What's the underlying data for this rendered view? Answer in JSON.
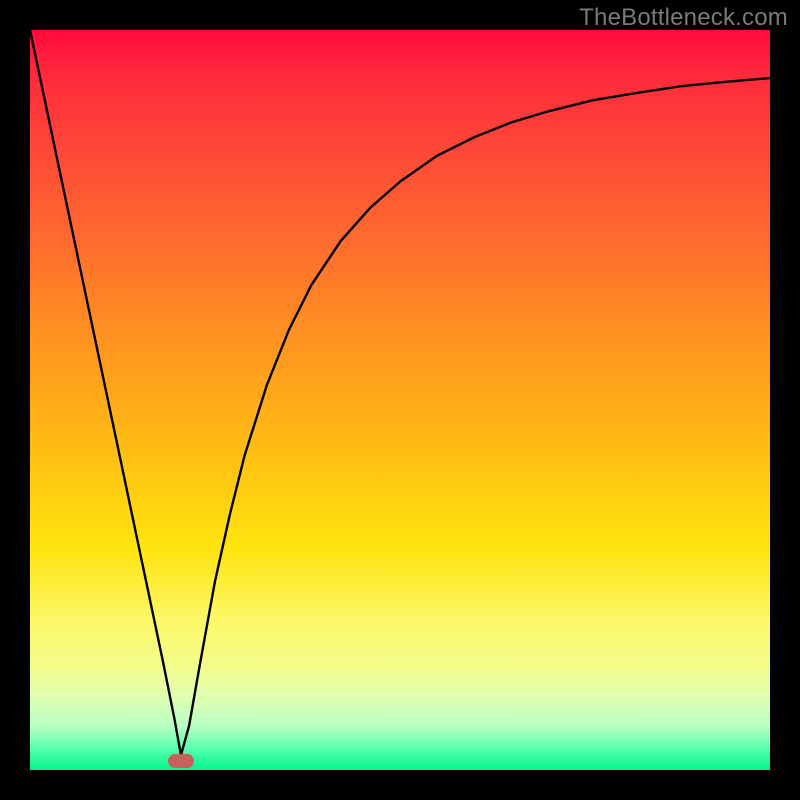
{
  "watermark": "TheBottleneck.com",
  "gradient_colors": {
    "top": "#ff0a3c",
    "mid_upper": "#ff6a2f",
    "mid": "#ffe40e",
    "mid_lower": "#f4fc8b",
    "bottom": "#00f58c"
  },
  "marker": {
    "x_frac": 0.204,
    "y_frac": 0.988,
    "color": "#c9605e"
  },
  "chart_data": {
    "type": "line",
    "title": "",
    "xlabel": "",
    "ylabel": "",
    "xlim": [
      0,
      1
    ],
    "ylim": [
      0,
      1
    ],
    "grid": false,
    "series": [
      {
        "name": "curve",
        "x": [
          0.0,
          0.02,
          0.04,
          0.06,
          0.08,
          0.1,
          0.12,
          0.14,
          0.16,
          0.18,
          0.195,
          0.204,
          0.215,
          0.23,
          0.25,
          0.27,
          0.29,
          0.32,
          0.35,
          0.38,
          0.42,
          0.46,
          0.5,
          0.55,
          0.6,
          0.65,
          0.7,
          0.76,
          0.82,
          0.88,
          0.94,
          1.0
        ],
        "y": [
          1.0,
          0.905,
          0.81,
          0.715,
          0.62,
          0.525,
          0.43,
          0.335,
          0.24,
          0.145,
          0.07,
          0.02,
          0.06,
          0.145,
          0.255,
          0.345,
          0.425,
          0.52,
          0.595,
          0.655,
          0.715,
          0.76,
          0.795,
          0.83,
          0.855,
          0.875,
          0.89,
          0.905,
          0.915,
          0.924,
          0.93,
          0.935
        ]
      }
    ],
    "annotations": [
      {
        "type": "marker",
        "x": 0.204,
        "y": 0.012,
        "shape": "rounded-rect",
        "color": "#c9605e"
      }
    ]
  }
}
